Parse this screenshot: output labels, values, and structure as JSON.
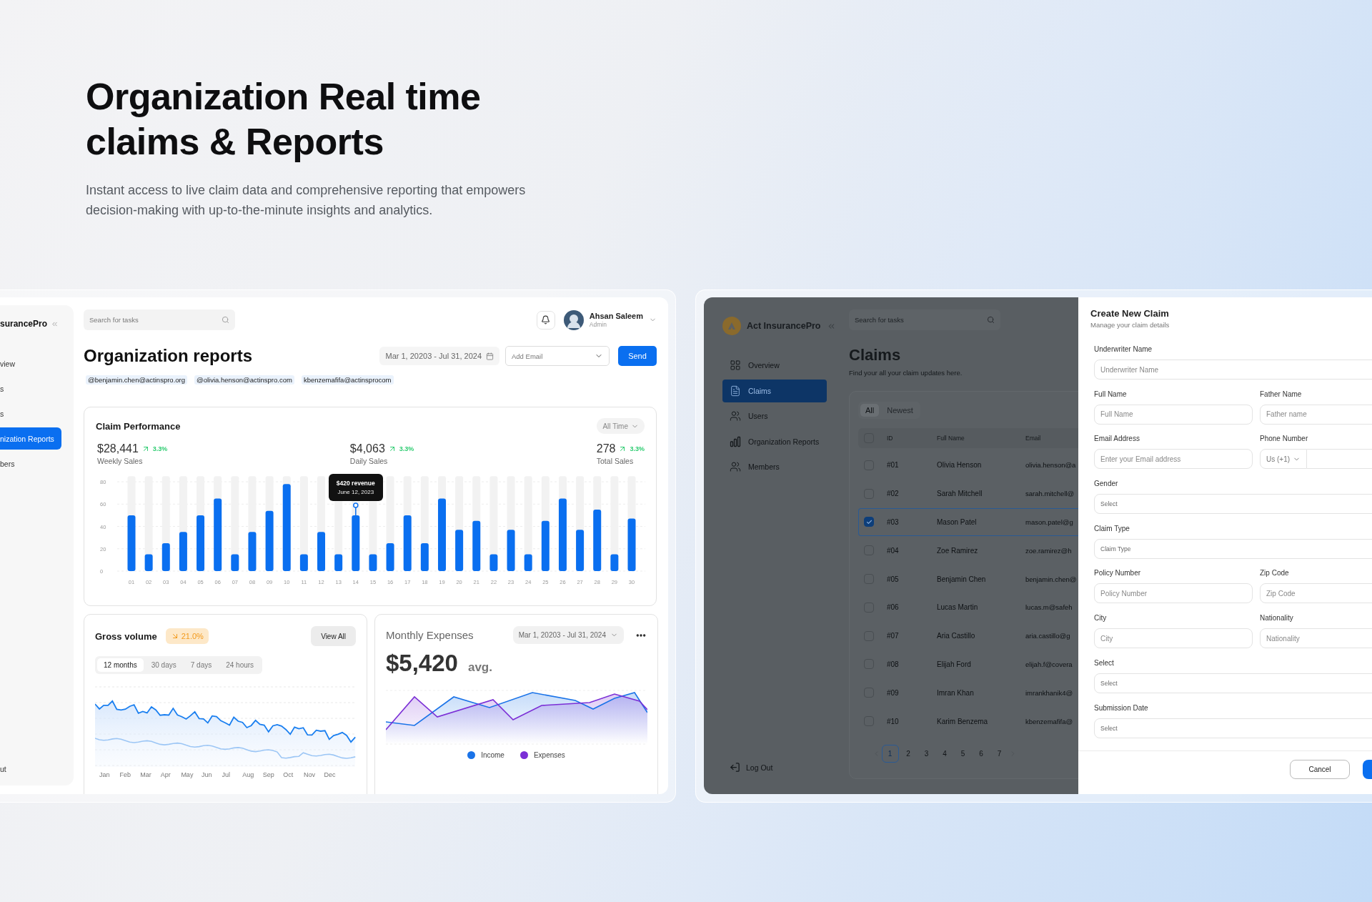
{
  "hero": {
    "title": "Organization Real time claims & Reports",
    "subtitle": "Instant access to live claim data and comprehensive reporting that empowers decision-making with up-to-the-minute insights and analytics."
  },
  "reports_app": {
    "sidebar": {
      "brand": "surancePro",
      "items": [
        {
          "label": "view",
          "selected": false
        },
        {
          "label": "s",
          "selected": false
        },
        {
          "label": "s",
          "selected": false
        },
        {
          "label": "nization Reports",
          "selected": true
        },
        {
          "label": "bers",
          "selected": false
        }
      ],
      "logout": "ut"
    },
    "search": {
      "placeholder": "Search for tasks"
    },
    "user": {
      "name": "Ahsan Saleem",
      "role": "Admin"
    },
    "title": "Organization reports",
    "date_range": "Mar 1, 20203 - Jul 31, 2024",
    "email_select": {
      "placeholder": "Add Email"
    },
    "send_button": "Send",
    "emails": [
      "@benjamin.chen@actinspro.org",
      "@olivia.henson@actinspro.com",
      "kbenzemafifa@actinsprocom"
    ],
    "claim_performance": {
      "title": "Claim Performance",
      "filter": "All Time",
      "stats": [
        {
          "value": "$28,441",
          "change": "3.3%",
          "label": "Weekly Sales"
        },
        {
          "value": "$4,063",
          "change": "3.3%",
          "label": "Daily Sales"
        },
        {
          "value": "278",
          "change": "3.3%",
          "label": "Total Sales"
        }
      ],
      "chart_data": {
        "type": "bar",
        "categories": [
          "01",
          "02",
          "03",
          "04",
          "05",
          "06",
          "07",
          "08",
          "09",
          "10",
          "11",
          "12",
          "13",
          "14",
          "15",
          "16",
          "17",
          "18",
          "19",
          "20",
          "21",
          "22",
          "23",
          "24",
          "25",
          "26",
          "27",
          "28",
          "29",
          "30"
        ],
        "values": [
          50,
          15,
          25,
          35,
          50,
          65,
          15,
          35,
          54,
          78,
          15,
          35,
          15,
          50,
          15,
          25,
          50,
          25,
          65,
          37,
          45,
          15,
          37,
          15,
          45,
          65,
          37,
          55,
          15,
          47
        ],
        "yticks": [
          0,
          20,
          40,
          60,
          80
        ],
        "ylim": [
          0,
          85
        ],
        "grid": true,
        "annotations": [
          "$420 revenue",
          "June 12, 2023"
        ]
      }
    },
    "gross_volume": {
      "title": "Gross volume",
      "change": "21.0%",
      "view_all": "View All",
      "ranges": [
        {
          "label": "12 months",
          "selected": true
        },
        {
          "label": "30 days",
          "selected": false
        },
        {
          "label": "7 days",
          "selected": false
        },
        {
          "label": "24 hours",
          "selected": false
        }
      ],
      "months": [
        "Jan",
        "Feb",
        "Mar",
        "Apr",
        "May",
        "Jun",
        "Jul",
        "Aug",
        "Sep",
        "Oct",
        "Nov",
        "Dec"
      ]
    },
    "monthly_expenses": {
      "title": "Monthly Expenses",
      "date_range": "Mar 1, 20203 - Jul 31, 2024",
      "amount": "$5,420",
      "unit": "avg.",
      "legend": [
        {
          "label": "Income",
          "color": "#1a73e8"
        },
        {
          "label": "Expenses",
          "color": "#7b2fd6"
        }
      ]
    }
  },
  "claims_app": {
    "brand": "Act InsurancePro",
    "nav": [
      {
        "label": "Overview",
        "kind": "grid",
        "selected": false
      },
      {
        "label": "Claims",
        "kind": "list",
        "selected": true
      },
      {
        "label": "Users",
        "kind": "users",
        "selected": false
      },
      {
        "label": "Organization Reports",
        "kind": "chart",
        "selected": false
      },
      {
        "label": "Members",
        "kind": "members",
        "selected": false
      }
    ],
    "logout": "Log Out",
    "search": {
      "placeholder": "Search for tasks"
    },
    "title": "Claims",
    "subtitle": "Find your all your claim updates here.",
    "tabs": [
      {
        "label": "All",
        "selected": true
      },
      {
        "label": "Newest",
        "selected": false
      }
    ],
    "all_selected": false,
    "columns": [
      "ID",
      "Full Name",
      "Email"
    ],
    "rows": [
      {
        "id": "#01",
        "name": "Olivia Henson",
        "email": "olivia.henson@a",
        "selected": false
      },
      {
        "id": "#02",
        "name": "Sarah Mitchell",
        "email": "sarah.mitchell@",
        "selected": false
      },
      {
        "id": "#03",
        "name": "Mason Patel",
        "email": "mason.patel@g",
        "selected": true
      },
      {
        "id": "#04",
        "name": "Zoe Ramirez",
        "email": "zoe.ramirez@h",
        "selected": false
      },
      {
        "id": "#05",
        "name": "Benjamin Chen",
        "email": "benjamin.chen@",
        "selected": false
      },
      {
        "id": "#06",
        "name": "Lucas Martin",
        "email": "lucas.m@safeh",
        "selected": false
      },
      {
        "id": "#07",
        "name": "Aria Castillo",
        "email": "aria.castillo@g",
        "selected": false
      },
      {
        "id": "#08",
        "name": "Elijah Ford",
        "email": "elijah.f@covera",
        "selected": false
      },
      {
        "id": "#09",
        "name": "Imran Khan",
        "email": "imrankhanik4@",
        "selected": false
      },
      {
        "id": "#10",
        "name": "Karim Benzema",
        "email": "kbenzemafifa@",
        "selected": false
      }
    ],
    "pages": [
      {
        "label": "1",
        "selected": true
      },
      {
        "label": "2",
        "selected": false
      },
      {
        "label": "3",
        "selected": false
      },
      {
        "label": "4",
        "selected": false
      },
      {
        "label": "5",
        "selected": false
      },
      {
        "label": "6",
        "selected": false
      },
      {
        "label": "7",
        "selected": false
      }
    ]
  },
  "claim_modal": {
    "title": "Create New Claim",
    "subtitle": "Manage your claim details",
    "rows": [
      [
        {
          "label": "Underwriter Name",
          "placeholder": "Underwriter Name",
          "kind": "input"
        }
      ],
      [
        {
          "label": "Full Name",
          "placeholder": "Full Name",
          "kind": "input"
        },
        {
          "label": "Father Name",
          "placeholder": "Father name",
          "kind": "input"
        }
      ],
      [
        {
          "label": "Email Address",
          "placeholder": "Enter your Email address",
          "kind": "input"
        },
        {
          "label": "Phone Number",
          "code": "Us (+1)",
          "kind": "phone"
        }
      ],
      [
        {
          "label": "Gender",
          "placeholder": "Select",
          "kind": "select"
        }
      ],
      [
        {
          "label": "Claim Type",
          "placeholder": "Claim Type",
          "kind": "select"
        }
      ],
      [
        {
          "label": "Policy Number",
          "placeholder": "Policy Number",
          "kind": "input"
        },
        {
          "label": "Zip Code",
          "placeholder": "Zip Code",
          "kind": "input"
        }
      ],
      [
        {
          "label": "City",
          "placeholder": "City",
          "kind": "input"
        },
        {
          "label": "Nationality",
          "placeholder": "Nationality",
          "kind": "input"
        }
      ],
      [
        {
          "label": "Select",
          "placeholder": "Select",
          "kind": "select"
        }
      ],
      [
        {
          "label": "Submission Date",
          "placeholder": "Select",
          "kind": "select"
        }
      ]
    ],
    "cancel": "Cancel"
  }
}
